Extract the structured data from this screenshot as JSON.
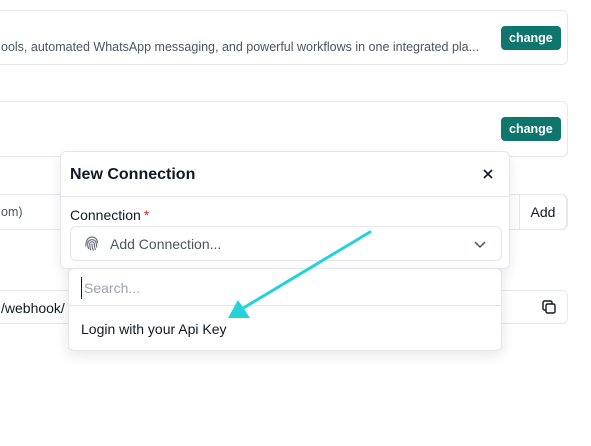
{
  "card1": {
    "description": "ools, automated WhatsApp messaging, and powerful workflows in one integrated pla...",
    "change_label": "change"
  },
  "card2": {
    "change_label": "change"
  },
  "url_input": {
    "placeholder_fragment": "om)",
    "add_label": "Add"
  },
  "webhook": {
    "value": "/webhook/",
    "copy_icon": "copy-icon"
  },
  "modal": {
    "title": "New Connection",
    "close_icon": "close-icon",
    "field_label": "Connection",
    "required_marker": "*",
    "select_placeholder": "Add Connection...",
    "select_icon": "fingerprint-icon",
    "chevron_icon": "chevron-down-icon"
  },
  "dropdown": {
    "search_placeholder": "Search...",
    "items": [
      {
        "label": "Login with your Api Key"
      }
    ]
  },
  "colors": {
    "accent": "#0f766e",
    "annotation_arrow": "#22d3d8",
    "required": "#dc2626"
  }
}
